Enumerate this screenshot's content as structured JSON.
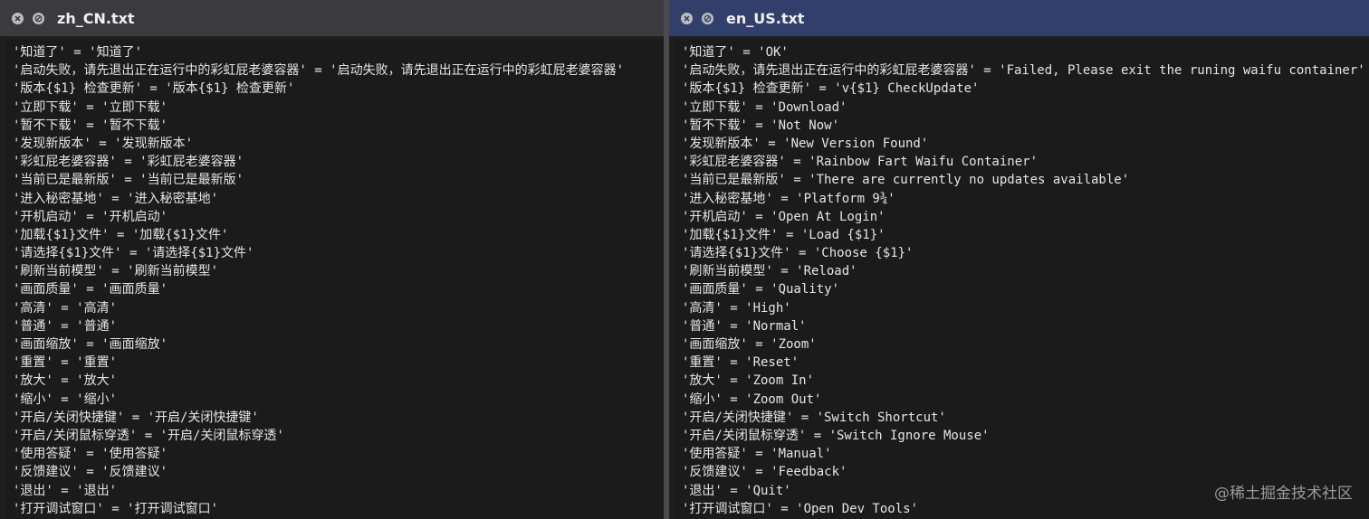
{
  "windows": {
    "left": {
      "title": "zh_CN.txt",
      "lines": [
        "'知道了' = '知道了'",
        "'启动失败，请先退出正在运行中的彩虹屁老婆容器' = '启动失败，请先退出正在运行中的彩虹屁老婆容器'",
        "'版本{$1} 检查更新' = '版本{$1} 检查更新'",
        "'立即下载' = '立即下载'",
        "'暂不下载' = '暂不下载'",
        "'发现新版本' = '发现新版本'",
        "'彩虹屁老婆容器' = '彩虹屁老婆容器'",
        "'当前已是最新版' = '当前已是最新版'",
        "'进入秘密基地' = '进入秘密基地'",
        "'开机启动' = '开机启动'",
        "'加载{$1}文件' = '加载{$1}文件'",
        "'请选择{$1}文件' = '请选择{$1}文件'",
        "'刷新当前模型' = '刷新当前模型'",
        "'画面质量' = '画面质量'",
        "'高清' = '高清'",
        "'普通' = '普通'",
        "'画面缩放' = '画面缩放'",
        "'重置' = '重置'",
        "'放大' = '放大'",
        "'缩小' = '缩小'",
        "'开启/关闭快捷键' = '开启/关闭快捷键'",
        "'开启/关闭鼠标穿透' = '开启/关闭鼠标穿透'",
        "'使用答疑' = '使用答疑'",
        "'反馈建议' = '反馈建议'",
        "'退出' = '退出'",
        "'打开调试窗口' = '打开调试窗口'"
      ]
    },
    "right": {
      "title": "en_US.txt",
      "lines": [
        "'知道了' = 'OK'",
        "'启动失败，请先退出正在运行中的彩虹屁老婆容器' = 'Failed, Please exit the runing waifu container'",
        "'版本{$1} 检查更新' = 'v{$1} CheckUpdate'",
        "'立即下载' = 'Download'",
        "'暂不下载' = 'Not Now'",
        "'发现新版本' = 'New Version Found'",
        "'彩虹屁老婆容器' = 'Rainbow Fart Waifu Container'",
        "'当前已是最新版' = 'There are currently no updates available'",
        "'进入秘密基地' = 'Platform 9¾'",
        "'开机启动' = 'Open At Login'",
        "'加载{$1}文件' = 'Load {$1}'",
        "'请选择{$1}文件' = 'Choose {$1}'",
        "'刷新当前模型' = 'Reload'",
        "'画面质量' = 'Quality'",
        "'高清' = 'High'",
        "'普通' = 'Normal'",
        "'画面缩放' = 'Zoom'",
        "'重置' = 'Reset'",
        "'放大' = 'Zoom In'",
        "'缩小' = 'Zoom Out'",
        "'开启/关闭快捷键' = 'Switch Shortcut'",
        "'开启/关闭鼠标穿透' = 'Switch Ignore Mouse'",
        "'使用答疑' = 'Manual'",
        "'反馈建议' = 'Feedback'",
        "'退出' = 'Quit'",
        "'打开调试窗口' = 'Open Dev Tools'"
      ]
    }
  },
  "icons": {
    "close": "close-icon",
    "block": "block-icon"
  },
  "watermark": "@稀土掘金技术社区"
}
